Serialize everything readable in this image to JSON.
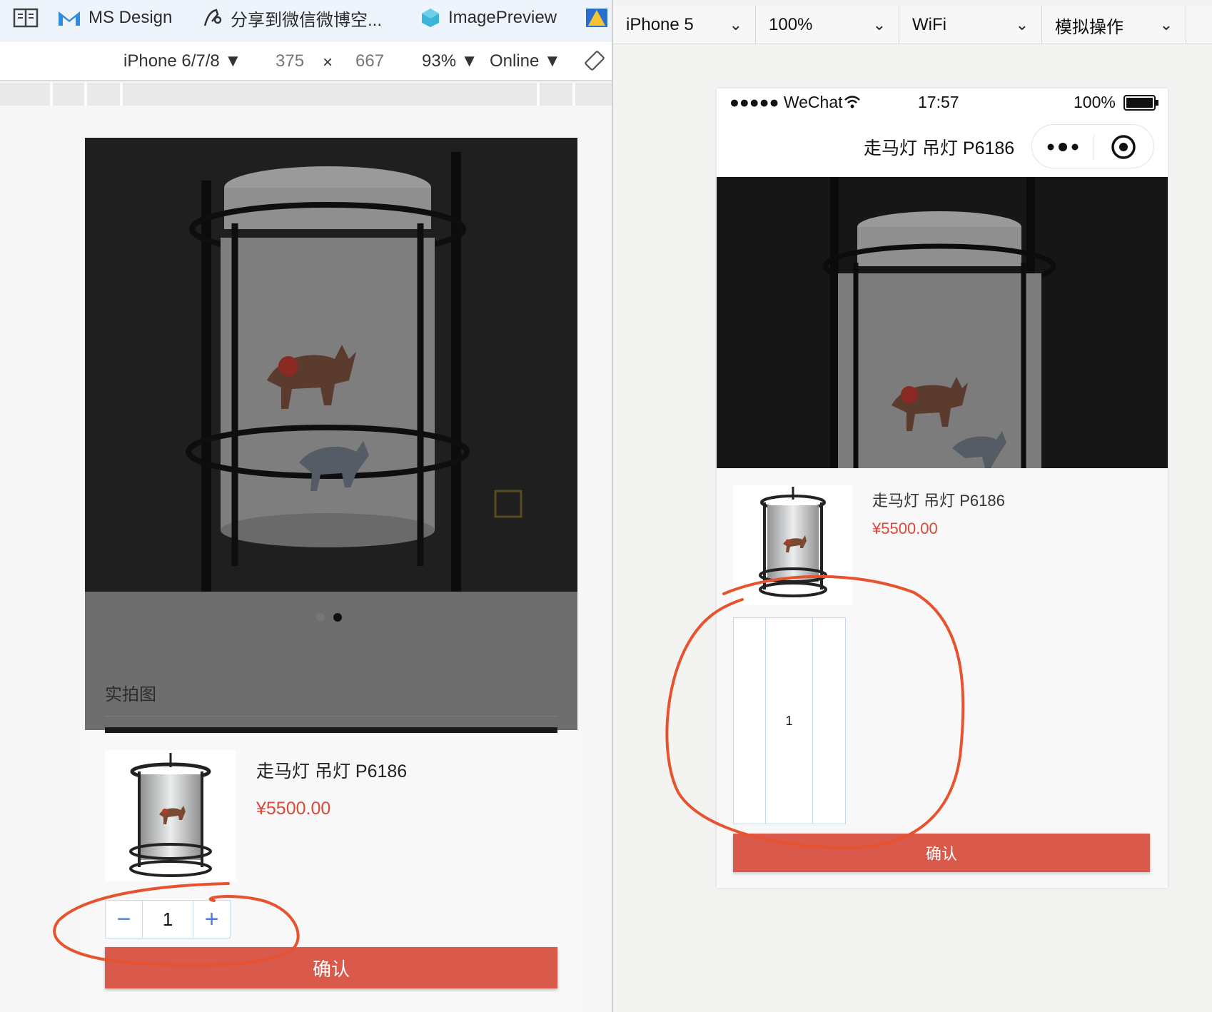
{
  "bookmarks": [
    {
      "label": "",
      "icon": "reader-icon"
    },
    {
      "label": "MS Design",
      "icon": "gmail-icon"
    },
    {
      "label": "分享到微信微博空...",
      "icon": "share-icon"
    },
    {
      "label": "ImagePreview",
      "icon": "cube-icon"
    }
  ],
  "devtools": {
    "device": "iPhone 6/7/8 ▼",
    "width": "375",
    "times": "×",
    "height": "667",
    "zoom": "93% ▼",
    "network": "Online ▼"
  },
  "left_page": {
    "section_title": "实拍图",
    "product_name": "走马灯 吊灯 P6186",
    "price": "¥5500.00",
    "minus": "−",
    "quantity": "1",
    "plus": "+",
    "confirm": "确认"
  },
  "simulator_toolbar": {
    "device": "iPhone 5",
    "zoom": "100%",
    "network": "WiFi",
    "simulate": "模拟操作"
  },
  "wechat": {
    "signal": "●●●●● WeChat",
    "time": "17:57",
    "battery": "100%",
    "nav_title": "走马灯 吊灯 P6186",
    "product_name": "走马灯 吊灯 P6186",
    "price": "¥5500.00",
    "quantity": "1",
    "confirm": "确认"
  },
  "colors": {
    "accent_red": "#d9594a",
    "price_red": "#d9483b",
    "annotation_orange": "#e8532f",
    "stepper_blue": "#4f7cd2"
  }
}
